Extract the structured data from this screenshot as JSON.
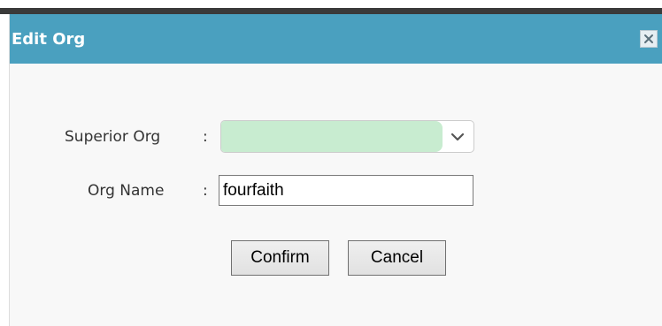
{
  "dialog": {
    "title": "Edit Org",
    "close_icon": "close-icon"
  },
  "form": {
    "superior_org": {
      "label": "Superior Org",
      "colon": ":",
      "value": "",
      "arrow_icon": "chevron-down-icon",
      "fill_color": "#c8ecd0"
    },
    "org_name": {
      "label": "Org Name",
      "colon": ":",
      "value": "fourfaith"
    }
  },
  "buttons": {
    "confirm": "Confirm",
    "cancel": "Cancel"
  },
  "colors": {
    "titlebar": "#4aa0bf",
    "background": "#f8f8f8"
  }
}
